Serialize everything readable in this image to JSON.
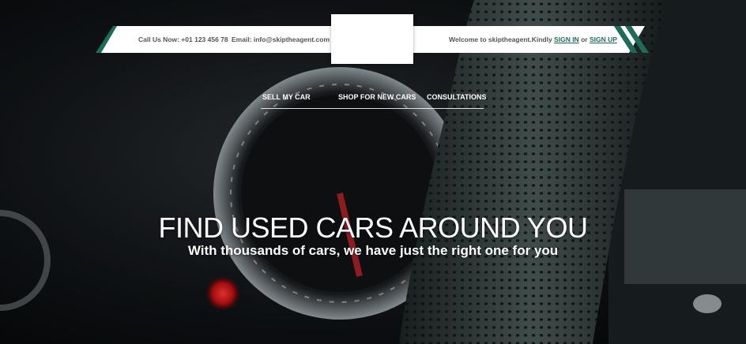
{
  "header": {
    "phone_text": "Call Us Now: +01 123 456 78",
    "email_text": "Email: info@skiptheagent.com",
    "welcome_prefix": "Welcome to skiptheagent.Kindly ",
    "sign_in_label": "SIGN IN",
    "or_text": " or ",
    "sign_up_label": "SIGN UP"
  },
  "nav": {
    "items": [
      {
        "label": "SELL MY CAR"
      },
      {
        "label": "SHOP FOR NEW CARS"
      },
      {
        "label": "CONSULTATIONS"
      }
    ]
  },
  "hero": {
    "title": "FIND USED CARS AROUND YOU",
    "subtitle": "With thousands of cars, we have just the right one for you"
  },
  "colors": {
    "accent": "#1f6b5a",
    "bar_background": "#ffffff",
    "text_muted": "#555555"
  }
}
